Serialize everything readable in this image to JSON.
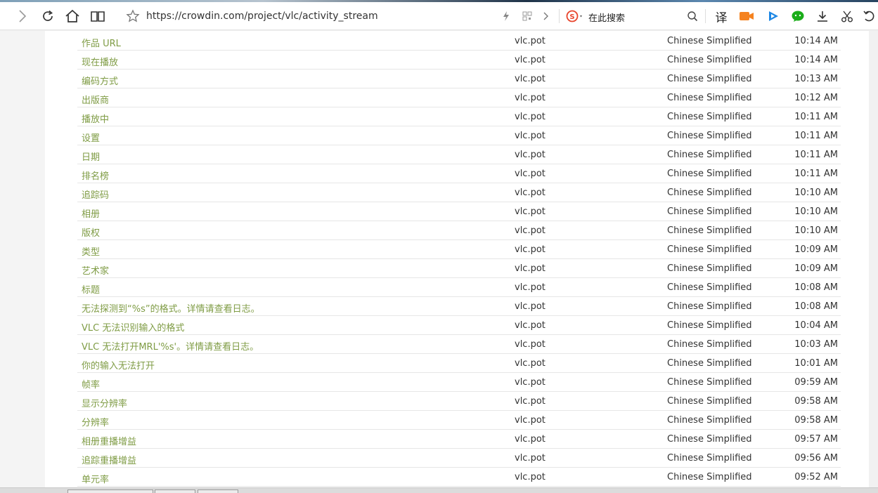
{
  "browser": {
    "url": "https://crowdin.com/project/vlc/activity_stream",
    "search_placeholder": "在此搜索",
    "translate_label": "译",
    "icons": {
      "forward": "chevron-right-icon",
      "reload": "reload-icon",
      "home": "home-icon",
      "reader": "book-icon",
      "favorite": "star-icon",
      "speed": "lightning-icon",
      "qr": "qr-code-icon",
      "next": "chevron-right-icon",
      "search_engine": "sogou-icon",
      "search": "search-icon",
      "video": "video-camera-icon",
      "play": "play-icon",
      "chat": "wechat-icon",
      "download": "download-icon",
      "cut": "scissors-icon",
      "undo": "undo-icon"
    },
    "colors": {
      "link_green": "#7f9c45",
      "video_orange": "#f5821f",
      "play_blue": "#1e88e5",
      "wechat_green": "#1aad19",
      "sogou_red": "#e8452c"
    }
  },
  "activity": {
    "rows": [
      {
        "text": "作品 URL",
        "file": "vlc.pot",
        "language": "Chinese Simplified",
        "time": "10:14 AM"
      },
      {
        "text": "现在播放",
        "file": "vlc.pot",
        "language": "Chinese Simplified",
        "time": "10:14 AM"
      },
      {
        "text": "编码方式",
        "file": "vlc.pot",
        "language": "Chinese Simplified",
        "time": "10:13 AM"
      },
      {
        "text": "出版商",
        "file": "vlc.pot",
        "language": "Chinese Simplified",
        "time": "10:12 AM"
      },
      {
        "text": "播放中",
        "file": "vlc.pot",
        "language": "Chinese Simplified",
        "time": "10:11 AM"
      },
      {
        "text": "设置",
        "file": "vlc.pot",
        "language": "Chinese Simplified",
        "time": "10:11 AM"
      },
      {
        "text": "日期",
        "file": "vlc.pot",
        "language": "Chinese Simplified",
        "time": "10:11 AM"
      },
      {
        "text": "排名榜",
        "file": "vlc.pot",
        "language": "Chinese Simplified",
        "time": "10:11 AM"
      },
      {
        "text": "追踪码",
        "file": "vlc.pot",
        "language": "Chinese Simplified",
        "time": "10:10 AM"
      },
      {
        "text": "相册",
        "file": "vlc.pot",
        "language": "Chinese Simplified",
        "time": "10:10 AM"
      },
      {
        "text": "版权",
        "file": "vlc.pot",
        "language": "Chinese Simplified",
        "time": "10:10 AM"
      },
      {
        "text": "类型",
        "file": "vlc.pot",
        "language": "Chinese Simplified",
        "time": "10:09 AM"
      },
      {
        "text": "艺术家",
        "file": "vlc.pot",
        "language": "Chinese Simplified",
        "time": "10:09 AM"
      },
      {
        "text": "标题",
        "file": "vlc.pot",
        "language": "Chinese Simplified",
        "time": "10:08 AM"
      },
      {
        "text": "无法探测到“%s”的格式。详情请查看日志。",
        "file": "vlc.pot",
        "language": "Chinese Simplified",
        "time": "10:08 AM"
      },
      {
        "text": "VLC 无法识别输入的格式",
        "file": "vlc.pot",
        "language": "Chinese Simplified",
        "time": "10:04 AM"
      },
      {
        "text": "VLC 无法打开MRL'%s'。详情请查看日志。",
        "file": "vlc.pot",
        "language": "Chinese Simplified",
        "time": "10:03 AM"
      },
      {
        "text": "你的输入无法打开",
        "file": "vlc.pot",
        "language": "Chinese Simplified",
        "time": "10:01 AM"
      },
      {
        "text": "帧率",
        "file": "vlc.pot",
        "language": "Chinese Simplified",
        "time": "09:59 AM"
      },
      {
        "text": "显示分辨率",
        "file": "vlc.pot",
        "language": "Chinese Simplified",
        "time": "09:58 AM"
      },
      {
        "text": "分辨率",
        "file": "vlc.pot",
        "language": "Chinese Simplified",
        "time": "09:58 AM"
      },
      {
        "text": "相册重播增益",
        "file": "vlc.pot",
        "language": "Chinese Simplified",
        "time": "09:57 AM"
      },
      {
        "text": "追踪重播增益",
        "file": "vlc.pot",
        "language": "Chinese Simplified",
        "time": "09:56 AM"
      },
      {
        "text": "单元率",
        "file": "vlc.pot",
        "language": "Chinese Simplified",
        "time": "09:52 AM"
      }
    ]
  }
}
